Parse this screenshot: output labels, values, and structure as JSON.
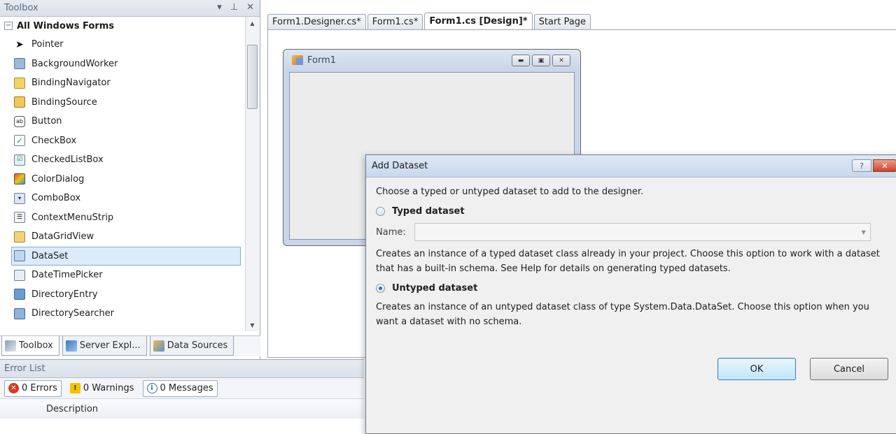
{
  "toolbox": {
    "title": "Toolbox",
    "title_icons": [
      "▾",
      "⊥",
      "✕"
    ],
    "group": {
      "toggle": "−",
      "label": "All Windows Forms"
    },
    "items": [
      {
        "label": "Pointer",
        "icon": "pointer-icon"
      },
      {
        "label": "BackgroundWorker",
        "icon": "background-worker-icon"
      },
      {
        "label": "BindingNavigator",
        "icon": "binding-navigator-icon"
      },
      {
        "label": "BindingSource",
        "icon": "binding-source-icon"
      },
      {
        "label": "Button",
        "icon": "button-icon"
      },
      {
        "label": "CheckBox",
        "icon": "checkbox-icon"
      },
      {
        "label": "CheckedListBox",
        "icon": "checked-list-box-icon"
      },
      {
        "label": "ColorDialog",
        "icon": "color-dialog-icon"
      },
      {
        "label": "ComboBox",
        "icon": "combo-box-icon"
      },
      {
        "label": "ContextMenuStrip",
        "icon": "context-menu-strip-icon"
      },
      {
        "label": "DataGridView",
        "icon": "data-grid-view-icon"
      },
      {
        "label": "DataSet",
        "icon": "dataset-icon",
        "selected": true
      },
      {
        "label": "DateTimePicker",
        "icon": "date-time-picker-icon"
      },
      {
        "label": "DirectoryEntry",
        "icon": "directory-entry-icon"
      },
      {
        "label": "DirectorySearcher",
        "icon": "directory-searcher-icon"
      }
    ],
    "tabs": [
      {
        "label": "Toolbox",
        "active": true
      },
      {
        "label": "Server Expl...",
        "active": false
      },
      {
        "label": "Data Sources",
        "active": false
      }
    ]
  },
  "error_list": {
    "title": "Error List",
    "errors_label": "0 Errors",
    "warnings_label": "0 Warnings",
    "messages_label": "0 Messages",
    "column_description": "Description"
  },
  "doc_tabs": [
    {
      "label": "Form1.Designer.cs*",
      "active": false
    },
    {
      "label": "Form1.cs*",
      "active": false
    },
    {
      "label": "Form1.cs [Design]*",
      "active": true
    },
    {
      "label": "Start Page",
      "active": false
    }
  ],
  "designer_form": {
    "title": "Form1"
  },
  "dialog": {
    "title": "Add Dataset",
    "help_label": "?",
    "close_label": "✕",
    "intro": "Choose a typed or untyped dataset to add to the designer.",
    "typed_label": "Typed dataset",
    "name_label": "Name:",
    "name_value": "",
    "typed_description": "Creates an instance of a typed dataset class already in your project. Choose this option to work with a dataset that has a built-in schema. See Help for details on generating typed datasets.",
    "untyped_label": "Untyped dataset",
    "untyped_description": "Creates an instance of an untyped dataset class of type System.Data.DataSet. Choose this option when you want a dataset with no schema.",
    "ok_label": "OK",
    "cancel_label": "Cancel",
    "selected_option": "untyped"
  }
}
